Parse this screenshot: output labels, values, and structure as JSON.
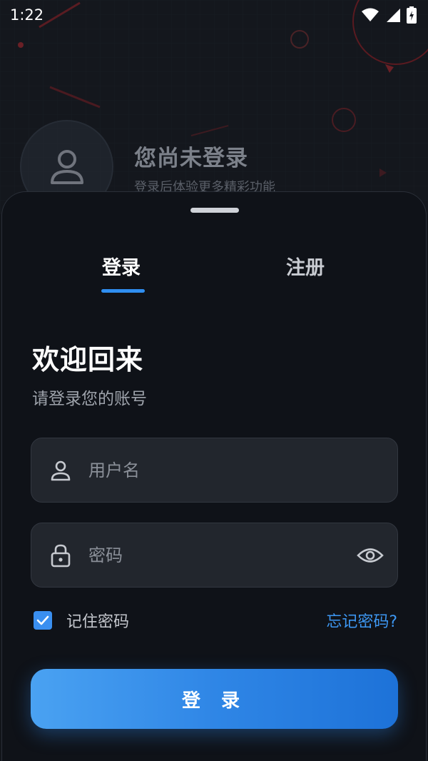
{
  "status_bar": {
    "time": "1:22",
    "icons": [
      "wifi-icon",
      "signal-icon",
      "battery-charging-icon"
    ]
  },
  "profile": {
    "title": "您尚未登录",
    "subtitle": "登录后体验更多精彩功能",
    "avatar_icon": "user-icon"
  },
  "tabs": [
    {
      "label": "登录",
      "active": true
    },
    {
      "label": "注册",
      "active": false
    }
  ],
  "welcome": {
    "title": "欢迎回来",
    "subtitle": "请登录您的账号"
  },
  "form": {
    "username": {
      "placeholder": "用户名",
      "value": "",
      "icon": "user-icon"
    },
    "password": {
      "placeholder": "密码",
      "value": "",
      "icon": "lock-icon",
      "toggle_icon": "eye-icon"
    },
    "remember_me": {
      "label": "记住密码",
      "checked": true
    },
    "forgot_password": "忘记密码?",
    "submit_label": "登 录"
  },
  "colors": {
    "accent": "#2f8ef0",
    "background": "#0f1218",
    "field": "#22262d"
  }
}
